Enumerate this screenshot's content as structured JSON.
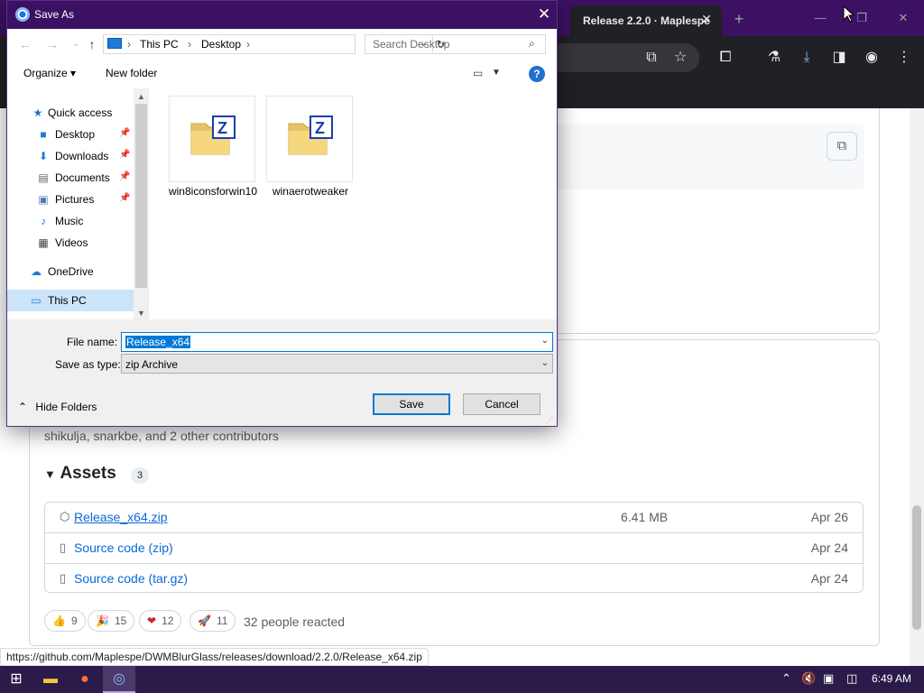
{
  "browser": {
    "active_tab_title": "Release 2.2.0 · Maplespe",
    "tab_close": "✕",
    "new_tab": "+",
    "window_minimize": "—",
    "window_maximize": "❐",
    "window_close": "✕"
  },
  "dialog": {
    "title": "Save As",
    "close": "✕",
    "breadcrumb": [
      "This PC",
      "Desktop"
    ],
    "breadcrumb_sep": "›",
    "search_placeholder": "Search Desktop",
    "organize_label": "Organize ▾",
    "new_folder_label": "New folder",
    "help": "?",
    "nav_items": [
      {
        "label": "Quick access",
        "icon": "star-icon"
      },
      {
        "label": "Desktop",
        "icon": "desktop-icon",
        "pinned": true
      },
      {
        "label": "Downloads",
        "icon": "download-arrow-icon",
        "pinned": true
      },
      {
        "label": "Documents",
        "icon": "documents-icon",
        "pinned": true
      },
      {
        "label": "Pictures",
        "icon": "pictures-icon",
        "pinned": true
      },
      {
        "label": "Music",
        "icon": "music-icon"
      },
      {
        "label": "Videos",
        "icon": "videos-icon"
      },
      {
        "label": "OneDrive",
        "icon": "cloud-icon"
      },
      {
        "label": "This PC",
        "icon": "computer-icon",
        "selected": true
      }
    ],
    "files": [
      {
        "label": "win8iconsforwin10"
      },
      {
        "label": "winaerotweaker"
      }
    ],
    "file_name_label": "File name:",
    "file_name_value": "Release_x64",
    "save_type_label": "Save as type:",
    "save_type_value": "zip Archive",
    "hide_folders_label": "Hide Folders",
    "save_label": "Save",
    "cancel_label": "Cancel"
  },
  "page": {
    "contributors_text": "shikulja, snarkbe, and 2 other contributors",
    "assets_title": "Assets",
    "assets_count": "3",
    "assets": [
      {
        "name": "Release_x64.zip",
        "size": "6.41 MB",
        "date": "Apr 26",
        "icon": "package-icon"
      },
      {
        "name": "Source code (zip)",
        "size": "",
        "date": "Apr 24",
        "icon": "file-zip-icon"
      },
      {
        "name": "Source code (tar.gz)",
        "size": "",
        "date": "Apr 24",
        "icon": "file-zip-icon"
      }
    ],
    "reactions": [
      {
        "emoji": "👍",
        "count": "9"
      },
      {
        "emoji": "🎉",
        "count": "15"
      },
      {
        "emoji": "❤",
        "count": "12"
      },
      {
        "emoji": "🚀",
        "count": "11"
      }
    ],
    "reactions_text": "32 people reacted"
  },
  "status_url": "https://github.com/Maplespe/DWMBlurGlass/releases/download/2.2.0/Release_x64.zip",
  "taskbar": {
    "clock": "6:49 AM"
  },
  "colors": {
    "title_purple": "#3c1163",
    "link_blue": "#0969da",
    "selection_blue": "#0078d7"
  }
}
